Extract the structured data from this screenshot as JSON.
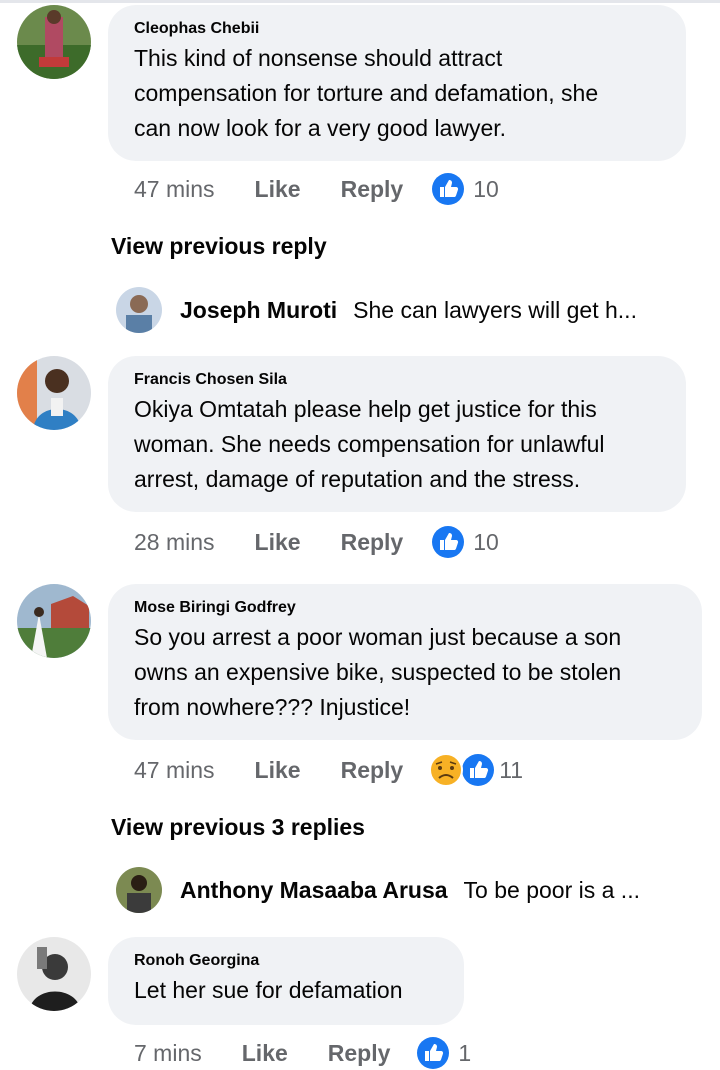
{
  "comments": [
    {
      "author": "Cleophas Chebii",
      "lines": [
        "This kind of nonsense should attract",
        "compensation for torture and defamation, she",
        "can now look for a very good lawyer."
      ],
      "time": "47 mins",
      "like_label": "Like",
      "reply_label": "Reply",
      "reaction_count": "10",
      "reaction_icon": "thumbs-up"
    },
    {
      "author": "Francis Chosen Sila",
      "lines": [
        "Okiya Omtatah  please help get justice for this",
        "woman. She needs compensation for unlawful",
        "arrest, damage of reputation and the stress."
      ],
      "time": "28 mins",
      "like_label": "Like",
      "reply_label": "Reply",
      "reaction_count": "10",
      "reaction_icon": "thumbs-up"
    },
    {
      "author": "Mose Biringi Godfrey",
      "lines": [
        "So you arrest a poor woman just because a son",
        "owns an expensive bike, suspected to be stolen",
        "from nowhere??? Injustice!"
      ],
      "time": "47 mins",
      "like_label": "Like",
      "reply_label": "Reply",
      "reaction_count": "11",
      "reaction_icon": "sad-and-thumbs-up"
    },
    {
      "author": "Ronoh Georgina",
      "lines": [
        "Let her sue for defamation"
      ],
      "time": "7 mins",
      "like_label": "Like",
      "reply_label": "Reply",
      "reaction_count": "1",
      "reaction_icon": "thumbs-up"
    }
  ],
  "view_previous": [
    "View previous reply",
    "View previous 3 replies"
  ],
  "replies": [
    {
      "author": "Joseph Muroti",
      "text": "She can lawyers will get h..."
    },
    {
      "author": "Anthony Masaaba Arusa",
      "text": "To be poor is a ..."
    }
  ],
  "colors": {
    "like_blue": "#1877f2",
    "bubble": "#f0f2f5",
    "meta_gray": "#65676b",
    "sad_yellow": "#f7b125"
  }
}
